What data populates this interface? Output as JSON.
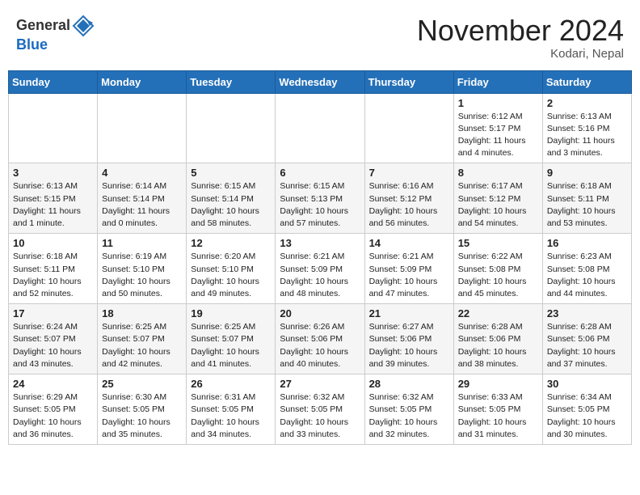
{
  "header": {
    "logo_general": "General",
    "logo_blue": "Blue",
    "month_title": "November 2024",
    "location": "Kodari, Nepal"
  },
  "calendar": {
    "days_of_week": [
      "Sunday",
      "Monday",
      "Tuesday",
      "Wednesday",
      "Thursday",
      "Friday",
      "Saturday"
    ],
    "weeks": [
      [
        {
          "day": "",
          "info": ""
        },
        {
          "day": "",
          "info": ""
        },
        {
          "day": "",
          "info": ""
        },
        {
          "day": "",
          "info": ""
        },
        {
          "day": "",
          "info": ""
        },
        {
          "day": "1",
          "info": "Sunrise: 6:12 AM\nSunset: 5:17 PM\nDaylight: 11 hours\nand 4 minutes."
        },
        {
          "day": "2",
          "info": "Sunrise: 6:13 AM\nSunset: 5:16 PM\nDaylight: 11 hours\nand 3 minutes."
        }
      ],
      [
        {
          "day": "3",
          "info": "Sunrise: 6:13 AM\nSunset: 5:15 PM\nDaylight: 11 hours\nand 1 minute."
        },
        {
          "day": "4",
          "info": "Sunrise: 6:14 AM\nSunset: 5:14 PM\nDaylight: 11 hours\nand 0 minutes."
        },
        {
          "day": "5",
          "info": "Sunrise: 6:15 AM\nSunset: 5:14 PM\nDaylight: 10 hours\nand 58 minutes."
        },
        {
          "day": "6",
          "info": "Sunrise: 6:15 AM\nSunset: 5:13 PM\nDaylight: 10 hours\nand 57 minutes."
        },
        {
          "day": "7",
          "info": "Sunrise: 6:16 AM\nSunset: 5:12 PM\nDaylight: 10 hours\nand 56 minutes."
        },
        {
          "day": "8",
          "info": "Sunrise: 6:17 AM\nSunset: 5:12 PM\nDaylight: 10 hours\nand 54 minutes."
        },
        {
          "day": "9",
          "info": "Sunrise: 6:18 AM\nSunset: 5:11 PM\nDaylight: 10 hours\nand 53 minutes."
        }
      ],
      [
        {
          "day": "10",
          "info": "Sunrise: 6:18 AM\nSunset: 5:11 PM\nDaylight: 10 hours\nand 52 minutes."
        },
        {
          "day": "11",
          "info": "Sunrise: 6:19 AM\nSunset: 5:10 PM\nDaylight: 10 hours\nand 50 minutes."
        },
        {
          "day": "12",
          "info": "Sunrise: 6:20 AM\nSunset: 5:10 PM\nDaylight: 10 hours\nand 49 minutes."
        },
        {
          "day": "13",
          "info": "Sunrise: 6:21 AM\nSunset: 5:09 PM\nDaylight: 10 hours\nand 48 minutes."
        },
        {
          "day": "14",
          "info": "Sunrise: 6:21 AM\nSunset: 5:09 PM\nDaylight: 10 hours\nand 47 minutes."
        },
        {
          "day": "15",
          "info": "Sunrise: 6:22 AM\nSunset: 5:08 PM\nDaylight: 10 hours\nand 45 minutes."
        },
        {
          "day": "16",
          "info": "Sunrise: 6:23 AM\nSunset: 5:08 PM\nDaylight: 10 hours\nand 44 minutes."
        }
      ],
      [
        {
          "day": "17",
          "info": "Sunrise: 6:24 AM\nSunset: 5:07 PM\nDaylight: 10 hours\nand 43 minutes."
        },
        {
          "day": "18",
          "info": "Sunrise: 6:25 AM\nSunset: 5:07 PM\nDaylight: 10 hours\nand 42 minutes."
        },
        {
          "day": "19",
          "info": "Sunrise: 6:25 AM\nSunset: 5:07 PM\nDaylight: 10 hours\nand 41 minutes."
        },
        {
          "day": "20",
          "info": "Sunrise: 6:26 AM\nSunset: 5:06 PM\nDaylight: 10 hours\nand 40 minutes."
        },
        {
          "day": "21",
          "info": "Sunrise: 6:27 AM\nSunset: 5:06 PM\nDaylight: 10 hours\nand 39 minutes."
        },
        {
          "day": "22",
          "info": "Sunrise: 6:28 AM\nSunset: 5:06 PM\nDaylight: 10 hours\nand 38 minutes."
        },
        {
          "day": "23",
          "info": "Sunrise: 6:28 AM\nSunset: 5:06 PM\nDaylight: 10 hours\nand 37 minutes."
        }
      ],
      [
        {
          "day": "24",
          "info": "Sunrise: 6:29 AM\nSunset: 5:05 PM\nDaylight: 10 hours\nand 36 minutes."
        },
        {
          "day": "25",
          "info": "Sunrise: 6:30 AM\nSunset: 5:05 PM\nDaylight: 10 hours\nand 35 minutes."
        },
        {
          "day": "26",
          "info": "Sunrise: 6:31 AM\nSunset: 5:05 PM\nDaylight: 10 hours\nand 34 minutes."
        },
        {
          "day": "27",
          "info": "Sunrise: 6:32 AM\nSunset: 5:05 PM\nDaylight: 10 hours\nand 33 minutes."
        },
        {
          "day": "28",
          "info": "Sunrise: 6:32 AM\nSunset: 5:05 PM\nDaylight: 10 hours\nand 32 minutes."
        },
        {
          "day": "29",
          "info": "Sunrise: 6:33 AM\nSunset: 5:05 PM\nDaylight: 10 hours\nand 31 minutes."
        },
        {
          "day": "30",
          "info": "Sunrise: 6:34 AM\nSunset: 5:05 PM\nDaylight: 10 hours\nand 30 minutes."
        }
      ]
    ]
  }
}
